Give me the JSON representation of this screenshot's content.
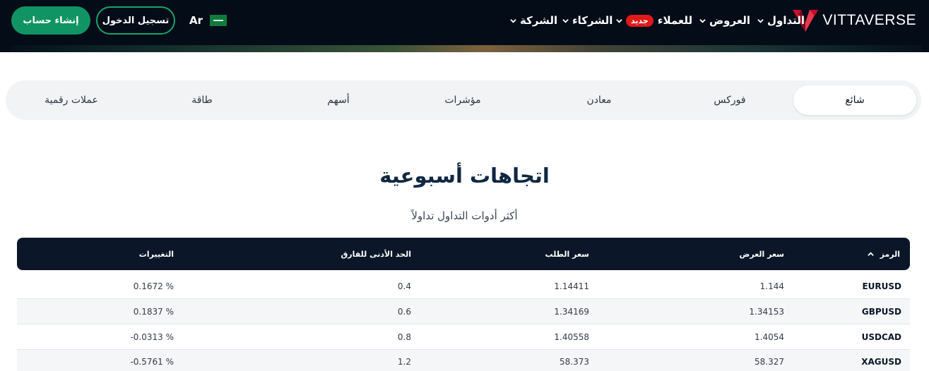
{
  "header": {
    "brand": "VITTAVERSE",
    "nav": {
      "trading": "التداول",
      "offers": "العروض",
      "clients": "للعملاء",
      "new_badge": "جديد",
      "partners": "الشركاء",
      "company": "الشركة"
    },
    "language": "Ar",
    "login_label": "تسجيل الدخول",
    "signup_label": "إنشاء حساب"
  },
  "tabs": [
    {
      "label": "شائع",
      "active": true
    },
    {
      "label": "فوركس",
      "active": false
    },
    {
      "label": "معادن",
      "active": false
    },
    {
      "label": "مؤشرات",
      "active": false
    },
    {
      "label": "أسهم",
      "active": false
    },
    {
      "label": "طاقة",
      "active": false
    },
    {
      "label": "عملات رقمية",
      "active": false
    }
  ],
  "section": {
    "title": "اتجاهات أسبوعية",
    "subtitle": "أكثر أدوات التداول تداولاً"
  },
  "table": {
    "columns": {
      "symbol": "الرمز",
      "bid": "سعر العرض",
      "ask": "سعر الطلب",
      "min_spread": "الحد الأدنى للفارق",
      "changes": "التغييرات"
    },
    "rows": [
      {
        "symbol": "EURUSD",
        "bid": "1.144",
        "ask": "1.14411",
        "min_spread": "0.4",
        "change": "0.1672 %"
      },
      {
        "symbol": "GBPUSD",
        "bid": "1.34153",
        "ask": "1.34169",
        "min_spread": "0.6",
        "change": "0.1837 %"
      },
      {
        "symbol": "USDCAD",
        "bid": "1.4054",
        "ask": "1.40558",
        "min_spread": "0.8",
        "change": "-0.0313 %"
      },
      {
        "symbol": "XAGUSD",
        "bid": "58.327",
        "ask": "58.373",
        "min_spread": "1.2",
        "change": "-0.5761 %"
      }
    ]
  },
  "colors": {
    "header_bg": "#030c17",
    "brand_red": "#c8102e",
    "accent_green": "#109463",
    "badge_red": "#e01919",
    "table_head_bg": "#0b1728"
  },
  "icons": {
    "logo": "vittaverse-logo-mark",
    "nav_dropdown": "chevron-down-icon",
    "language_flag": "saudi-flag-icon",
    "sort": "chevron-up-icon"
  }
}
